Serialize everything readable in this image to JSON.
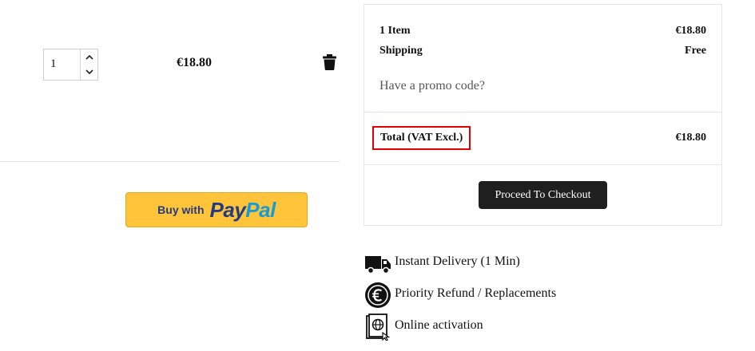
{
  "cart_item": {
    "quantity": "1",
    "price": "€18.80"
  },
  "paypal": {
    "buy_with": "Buy with",
    "brand_pay": "Pay",
    "brand_pal": "Pal"
  },
  "summary": {
    "items_label": "1 Item",
    "items_value": "€18.80",
    "shipping_label": "Shipping",
    "shipping_value": "Free",
    "promo_link": "Have a promo code?",
    "total_label": "Total (VAT Excl.)",
    "total_value": "€18.80",
    "checkout_label": "Proceed To Checkout"
  },
  "features": [
    {
      "icon": "delivery-truck-icon",
      "label": "Instant Delivery (1 Min)"
    },
    {
      "icon": "euro-refund-icon",
      "label": "Priority Refund / Replacements"
    },
    {
      "icon": "online-activation-icon",
      "label": "Online activation"
    }
  ],
  "colors": {
    "paypal_yellow": "#ffc439",
    "paypal_dark_blue": "#253b80",
    "paypal_light_blue": "#179bd7",
    "highlight_red": "#e00000",
    "checkout_bg": "#1f1f1f"
  }
}
